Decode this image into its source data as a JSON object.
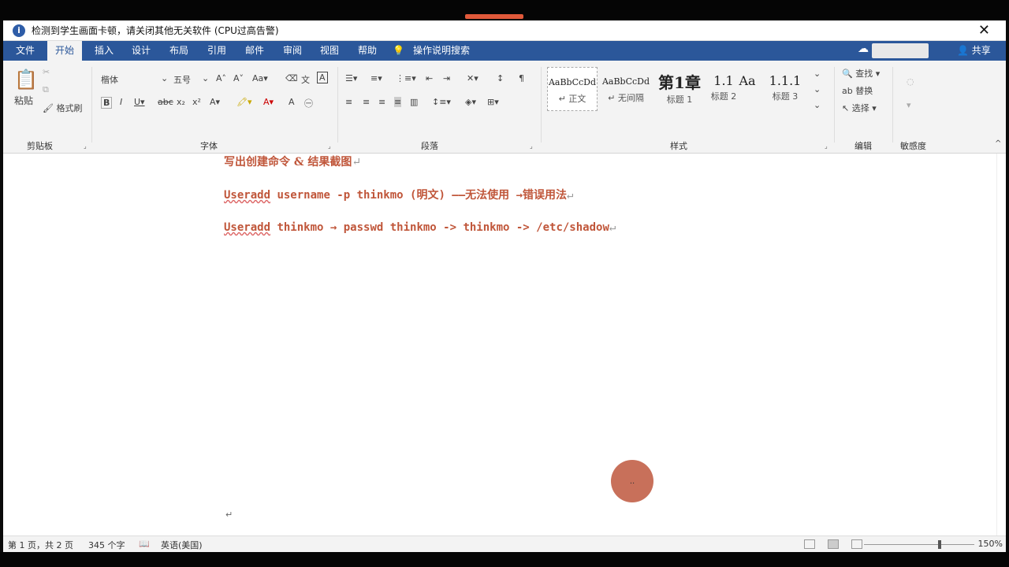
{
  "notice": {
    "text": "检测到学生画面卡顿，请关闭其他无关软件 (CPU过高告警)",
    "close": "✕"
  },
  "menu": {
    "tabs": [
      "文件",
      "开始",
      "插入",
      "设计",
      "布局",
      "引用",
      "邮件",
      "审阅",
      "视图",
      "帮助"
    ],
    "active": "开始",
    "search": "操作说明搜索",
    "share": "共享"
  },
  "ribbon": {
    "clipboard": {
      "label": "剪贴板",
      "paste": "粘贴",
      "format_painter": "格式刷"
    },
    "font": {
      "label": "字体",
      "font_name": "楷体",
      "font_size": "五号"
    },
    "paragraph": {
      "label": "段落"
    },
    "styles": {
      "label": "样式",
      "items": [
        {
          "sample": "AaBbCcDd",
          "name": "↵ 正文"
        },
        {
          "sample": "AaBbCcDd",
          "name": "↵ 无间隔"
        },
        {
          "sample": "第1章",
          "name": "标题 1"
        },
        {
          "sample": "1.1",
          "name": "标题 2"
        },
        {
          "sample": "Aa",
          "name": ""
        },
        {
          "sample": "1.1.1",
          "name": "标题 3"
        }
      ]
    },
    "editing": {
      "label": "编辑",
      "find": "查找",
      "replace": "替换",
      "select": "选择"
    },
    "sensitivity": {
      "label": "敏感度"
    }
  },
  "document": {
    "line1": "写出创建命令 & 结果截图",
    "line2_cmd": "Useradd",
    "line2_rest": " username -p thinkmo (明文) ——无法使用 →错误用法",
    "line3_cmd": "Useradd",
    "line3_rest": " thinkmo   → passwd thinkmo -> thinkmo -> /etc/shadow",
    "para_mark": "↵"
  },
  "status": {
    "page": "第 1 页，共 2 页",
    "words": "345 个字",
    "language": "英语(美国)",
    "zoom": "150%"
  },
  "cursor": {
    "label": ".."
  }
}
